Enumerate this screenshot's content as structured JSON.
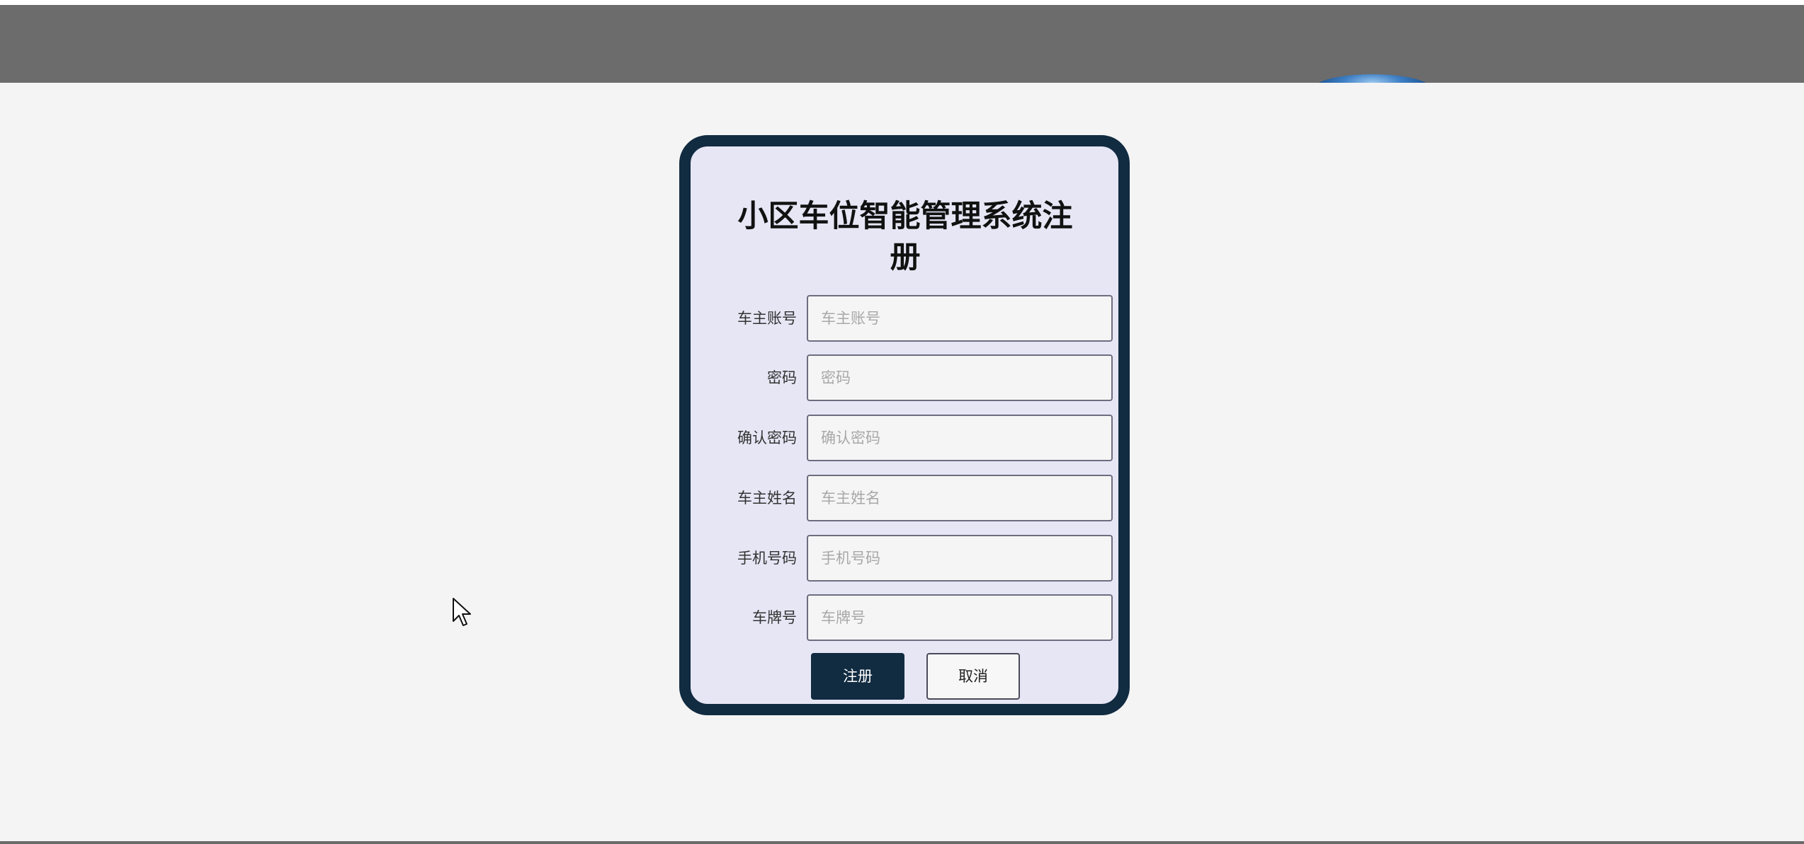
{
  "form": {
    "title": "小区车位智能管理系统注册",
    "fields": [
      {
        "label": "车主账号",
        "placeholder": "车主账号",
        "value": ""
      },
      {
        "label": "密码",
        "placeholder": "密码",
        "value": ""
      },
      {
        "label": "确认密码",
        "placeholder": "确认密码",
        "value": ""
      },
      {
        "label": "车主姓名",
        "placeholder": "车主姓名",
        "value": ""
      },
      {
        "label": "手机号码",
        "placeholder": "手机号码",
        "value": ""
      },
      {
        "label": "车牌号",
        "placeholder": "车牌号",
        "value": ""
      }
    ],
    "register_label": "注册",
    "cancel_label": "取消"
  },
  "colors": {
    "card_border": "#112b41",
    "card_background": "#e6e6f5",
    "primary_button": "#112b41",
    "page_background": "#f4f4f4",
    "banner": "#6c6c6c"
  },
  "icons": {
    "cursor": "mouse-pointer-icon"
  }
}
